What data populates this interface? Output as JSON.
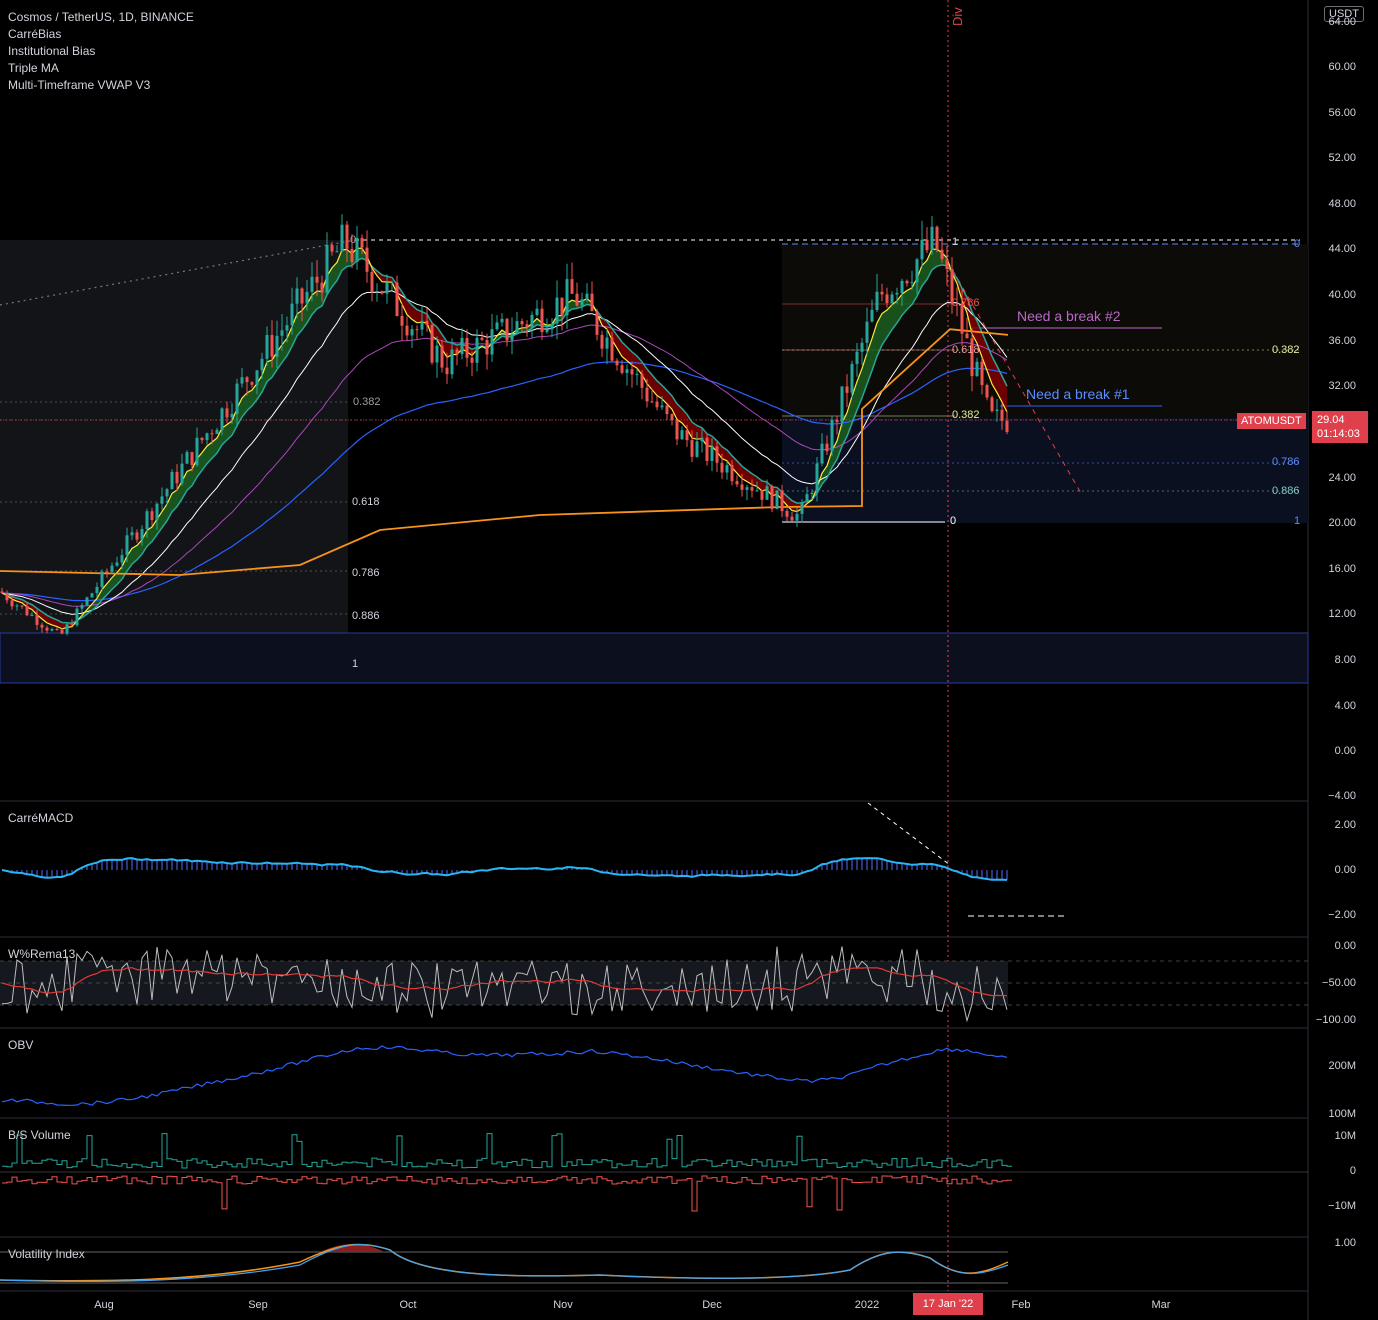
{
  "header": {
    "symbol_line": "Cosmos / TetherUS, 1D, BINANCE",
    "indicators": [
      "CarréBias",
      "Institutional Bias",
      "Triple MA",
      "Multi-Timeframe VWAP V3"
    ]
  },
  "currency_badge": "USDT",
  "price_scale": {
    "labels": [
      "60.00",
      "56.00",
      "52.00",
      "48.00",
      "44.00",
      "40.00",
      "36.00",
      "32.00",
      "28.00",
      "24.00",
      "20.00",
      "16.00",
      "12.00",
      "8.00",
      "4.00",
      "0.00",
      "−4.00"
    ],
    "top_partial": "64.00"
  },
  "current_price": {
    "ticker": "ATOMUSDT",
    "price": "29.04",
    "countdown": "01:14:03",
    "value": 29.04
  },
  "annotations": {
    "break2": "Need a break #2",
    "break1": "Need a break #1",
    "div": "Div"
  },
  "fib_left": [
    "0",
    "0.382",
    "0.618",
    "0.786",
    "0.886",
    "1"
  ],
  "fib_right_inner": [
    "1",
    "0.786",
    "0.618",
    "0.382",
    "0"
  ],
  "fib_right_outer": [
    "0",
    "0.382",
    "0.618",
    "0.786",
    "0.886",
    "1"
  ],
  "panes": {
    "macd": {
      "title": "CarréMACD",
      "scale": [
        "2.00",
        "0.00",
        "−2.00"
      ]
    },
    "wr": {
      "title": "W%Rema13",
      "scale": [
        "0.00",
        "−50.00",
        "−100.00"
      ]
    },
    "obv": {
      "title": "OBV",
      "scale": [
        "200M",
        "100M"
      ]
    },
    "bsvol": {
      "title": "B/S Volume",
      "scale": [
        "10M",
        "0",
        "−10M"
      ]
    },
    "vol": {
      "title": "Volatility Index",
      "scale": [
        "1.00"
      ]
    }
  },
  "time_axis": {
    "labels": [
      "Aug",
      "Sep",
      "Oct",
      "Nov",
      "Dec",
      "2022",
      "Feb",
      "Mar"
    ],
    "current_date": "17 Jan '22"
  },
  "colors": {
    "background": "#000000",
    "up": "#26a69a",
    "down": "#ef5350",
    "accent_red": "#e0404b",
    "vwap_blue": "#2962ff",
    "orange": "#f7931a",
    "purple": "#ab47bc",
    "macd_line": "#29b6f6"
  },
  "chart_data": {
    "type": "candlestick",
    "title": "Cosmos / TetherUS, 1D, BINANCE",
    "ylim": [
      -4,
      64
    ],
    "x_range": [
      "2021-07-13",
      "2022-03-20"
    ],
    "current_price": 29.04,
    "swing_points": [
      {
        "date": "2021-07-20",
        "price": 9.5
      },
      {
        "date": "2021-09-20",
        "price": 44.7
      },
      {
        "date": "2021-11-05",
        "price": 40.0
      },
      {
        "date": "2021-12-20",
        "price": 20.5
      },
      {
        "date": "2022-01-16",
        "price": 44.6
      },
      {
        "date": "2022-01-27",
        "price": 29.04
      }
    ],
    "horizontal_levels": [
      44.5,
      35.5,
      31.8,
      26.0,
      23.0,
      20.2,
      10.5,
      6.0
    ]
  }
}
